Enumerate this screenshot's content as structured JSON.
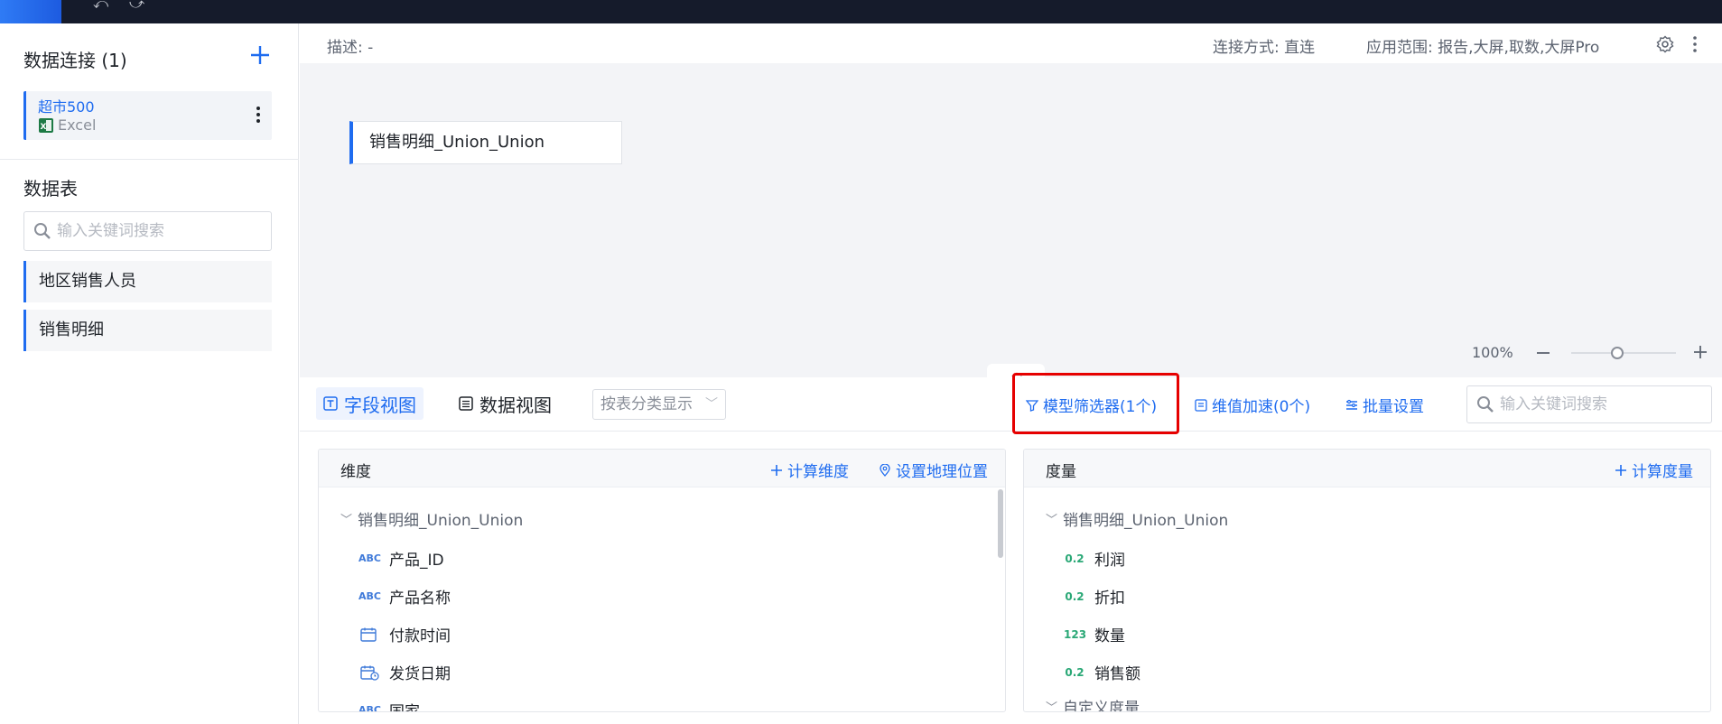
{
  "sidebar": {
    "title": "数据连接 (1)",
    "connection": {
      "name": "超市500",
      "type": "Excel"
    },
    "tables_title": "数据表",
    "search_placeholder": "输入关键词搜索",
    "tables": [
      "地区销售人员",
      "销售明细"
    ]
  },
  "header": {
    "description": "描述: -",
    "connection_mode": "连接方式: 直连",
    "scope": "应用范围: 报告,大屏,取数,大屏Pro"
  },
  "canvas": {
    "node_label": "销售明细_Union_Union",
    "zoom": "100%"
  },
  "toolbar": {
    "tab_field_view": "字段视图",
    "tab_data_view": "数据视图",
    "grouping": "按表分类显示",
    "model_filter": "模型筛选器(1个)",
    "dim_accel": "维值加速(0个)",
    "batch_settings": "批量设置",
    "search_placeholder": "输入关键词搜索"
  },
  "dimensions": {
    "title": "维度",
    "calc_btn": "计算维度",
    "geo_btn": "设置地理位置",
    "group": "销售明细_Union_Union",
    "fields": [
      {
        "type": "ABC",
        "name": "产品_ID"
      },
      {
        "type": "ABC",
        "name": "产品名称"
      },
      {
        "type": "date",
        "name": "付款时间"
      },
      {
        "type": "datetime",
        "name": "发货日期"
      },
      {
        "type": "ABC",
        "name": "国家"
      }
    ]
  },
  "measures": {
    "title": "度量",
    "calc_btn": "计算度量",
    "group": "销售明细_Union_Union",
    "fields": [
      {
        "type": "0.2",
        "name": "利润"
      },
      {
        "type": "0.2",
        "name": "折扣"
      },
      {
        "type": "123",
        "name": "数量"
      },
      {
        "type": "0.2",
        "name": "销售额"
      }
    ],
    "custom_group": "自定义度量"
  },
  "colors": {
    "accent": "#1f6cf0",
    "highlight": "#e60000"
  }
}
